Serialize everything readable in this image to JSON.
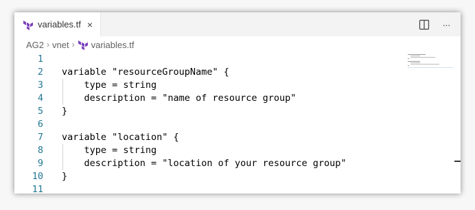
{
  "tab": {
    "label": "variables.tf",
    "close_glyph": "×",
    "icon": "terraform-icon"
  },
  "actions": {
    "split_icon": "split-editor-icon",
    "more_glyph": "···"
  },
  "breadcrumb": {
    "items": [
      "AG2",
      "vnet",
      "variables.tf"
    ],
    "separator": "›"
  },
  "editor": {
    "lines": [
      {
        "num": "1",
        "text": ""
      },
      {
        "num": "2",
        "text": "variable \"resourceGroupName\" {"
      },
      {
        "num": "3",
        "text": "    type = string"
      },
      {
        "num": "4",
        "text": "    description = \"name of resource group\""
      },
      {
        "num": "5",
        "text": "}"
      },
      {
        "num": "6",
        "text": ""
      },
      {
        "num": "7",
        "text": "variable \"location\" {"
      },
      {
        "num": "8",
        "text": "    type = string"
      },
      {
        "num": "9",
        "text": "    description = \"location of your resource group\""
      },
      {
        "num": "10",
        "text": "}"
      },
      {
        "num": "11",
        "text": ""
      }
    ]
  },
  "colors": {
    "line_number": "#237893",
    "terraform": "#7b42bc"
  }
}
